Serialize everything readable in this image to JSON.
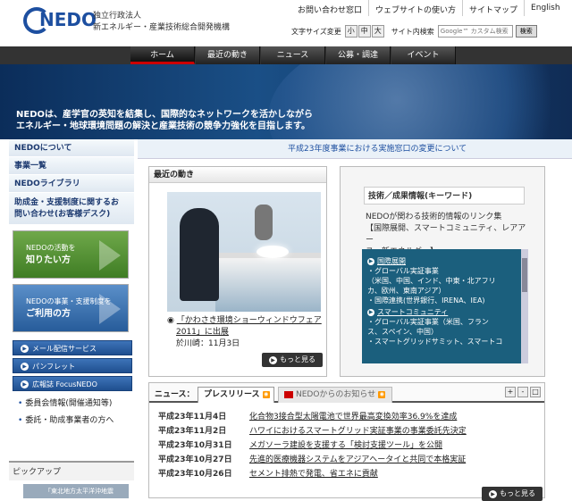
{
  "header": {
    "logo_text": "NEDO",
    "org_line1": "独立行政法人",
    "org_line2": "新エネルギー・産業技術総合開発機構",
    "top_links": [
      "お問い合わせ窓口",
      "ウェブサイトの使い方",
      "サイトマップ",
      "English"
    ],
    "font_size_label": "文字サイズ変更",
    "font_sizes": [
      "小",
      "中",
      "大"
    ],
    "search_label": "サイト内検索",
    "search_placeholder": "Google™ カスタム検索",
    "search_button": "検索"
  },
  "nav": {
    "tabs": [
      "ホーム",
      "最近の動き",
      "ニュース",
      "公募・調達",
      "イベント"
    ],
    "active": "ホーム"
  },
  "banner": {
    "line1": "NEDOは、産学官の英知を結集し、国際的なネットワークを活かしながら",
    "line2": "エネルギー・地球環境問題の解決と産業技術の競争力強化を目指します。"
  },
  "notice": "平成23年度事業における実施窓口の変更について",
  "sidebar": {
    "links": [
      "NEDOについて",
      "事業一覧",
      "NEDOライブラリ"
    ],
    "contact_line1": "助成金・支援制度に関するお",
    "contact_line2": "問い合わせ(お客様デスク)",
    "promo1_line1": "NEDOの活動を",
    "promo1_line2": "知りたい方",
    "promo2_line1": "NEDOの事業・支援制度を",
    "promo2_line2": "ご利用の方",
    "buttons": [
      "メール配信サービス",
      "パンフレット",
      "広報誌 FocusNEDO"
    ],
    "sublinks": [
      "委員会情報(開催通知等)",
      "委託・助成事業者の方へ"
    ],
    "pickup": "ピックアップ",
    "pickup_thumb": "「東北地方太平洋沖地震"
  },
  "news": {
    "title": "最近の動き",
    "caption_line1": "「かわさき環境ショーウィンドウフェア",
    "caption_line2": "2011」に出展",
    "caption_line3": "於川崎：11月3日",
    "more": "もっと見る"
  },
  "tech": {
    "title": "技術／成果情報(キーワード)",
    "desc_line1": "NEDOが関わる技術的情報のリンク集",
    "desc_line2": "【国際展開、スマートコミュニティ、レアアー",
    "desc_line3": "ス、新エネルギー】",
    "cat1": "国際展開",
    "cat1_items": [
      "・グローバル実証事業",
      "（米国、中国、インド、中東・北アフリ",
      "カ、欧州、東南アジア）",
      "・国際連携(世界銀行、IRENA、IEA)"
    ],
    "cat2": "スマートコミュニティ",
    "cat2_items": [
      "・グローバル実証事業（米国、フラン",
      "ス、スペイン、中国）",
      "・スマートグリッドサミット、スマートコ"
    ]
  },
  "press": {
    "label": "ニュース：",
    "tab1": "プレスリリース",
    "tab2": "NEDOからのお知らせ",
    "tools": [
      "+",
      "-",
      "□"
    ],
    "items": [
      {
        "date": "平成23年11月4日",
        "title": "化合物3接合型太陽電池で世界最高変換効率36.9%を達成"
      },
      {
        "date": "平成23年11月2日",
        "title": "ハワイにおけるスマートグリッド実証事業の事業委託先決定"
      },
      {
        "date": "平成23年10月31日",
        "title": "メガソーラ建設を支援する「検討支援ツール」を公開"
      },
      {
        "date": "平成23年10月27日",
        "title": "先進的医療機器システムをアジアヘータイと共同で本格実証"
      },
      {
        "date": "平成23年10月26日",
        "title": "セメント排熱で発電、省エネに貢献"
      }
    ],
    "more": "もっと見る"
  }
}
